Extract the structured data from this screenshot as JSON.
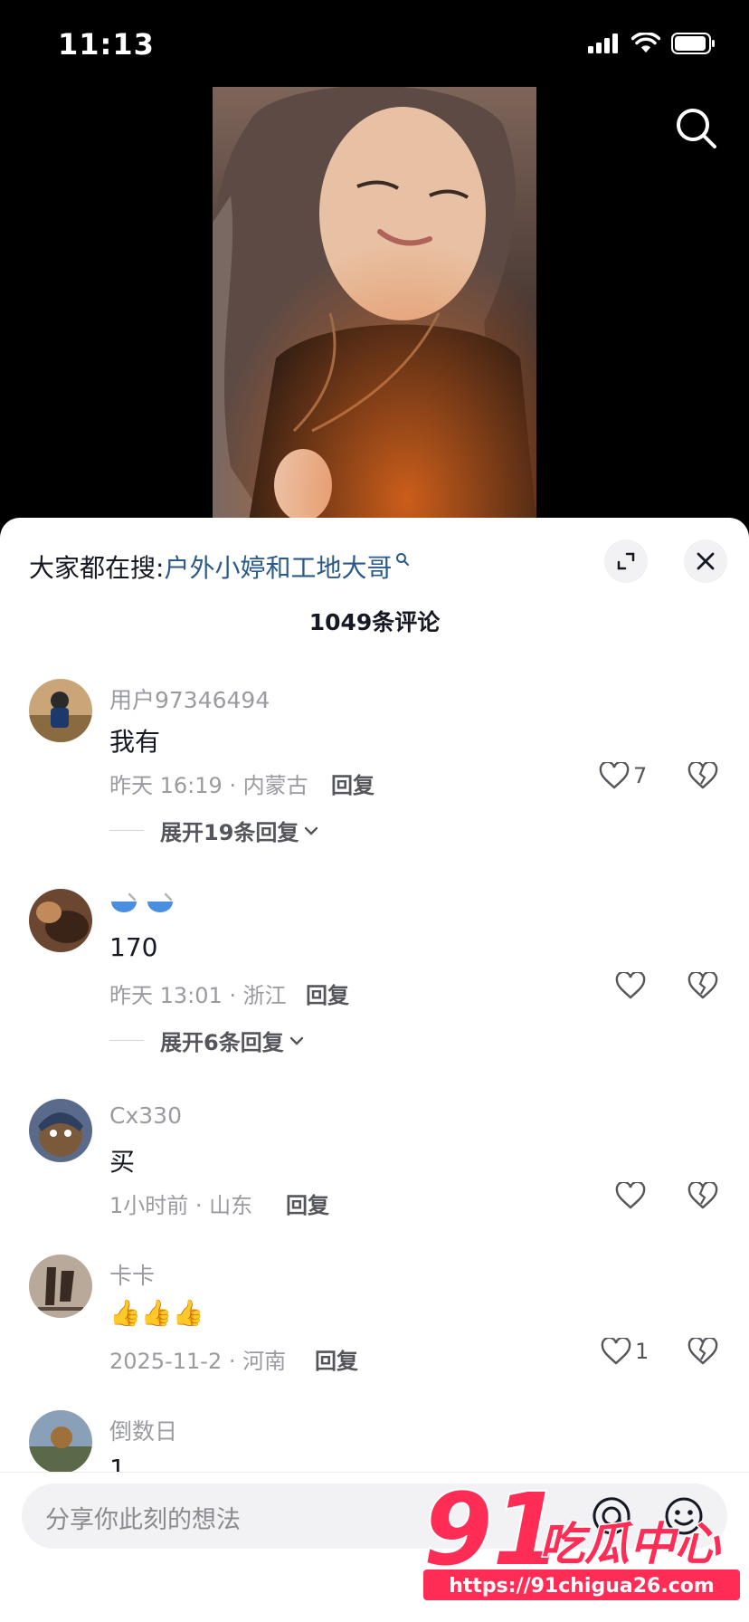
{
  "status": {
    "time": "11:13"
  },
  "hot_search": {
    "prefix": "大家都在搜:",
    "keyword": "户外小婷和工地大哥"
  },
  "comment_count": "1049条评论",
  "comments": [
    {
      "user": "用户97346494",
      "text": "我有",
      "meta": "昨天 16:19 · 内蒙古",
      "reply": "回复",
      "likes": "7",
      "expand": "展开19条回复"
    },
    {
      "user": "",
      "text": "170",
      "meta": "昨天 13:01 · 浙江",
      "reply": "回复",
      "likes": "",
      "expand": "展开6条回复"
    },
    {
      "user": "Cx330",
      "text": "买",
      "meta": "1小时前 · 山东",
      "reply": "回复",
      "likes": ""
    },
    {
      "user": "卡卡",
      "text": "👍👍👍",
      "meta": "2025-11-2 · 河南",
      "reply": "回复",
      "likes": "1"
    },
    {
      "user": "倒数日",
      "text": "1"
    }
  ],
  "input": {
    "placeholder": "分享你此刻的想法"
  },
  "watermark": {
    "brand": "91吃瓜中心",
    "url": "https://91chigua26.com"
  }
}
